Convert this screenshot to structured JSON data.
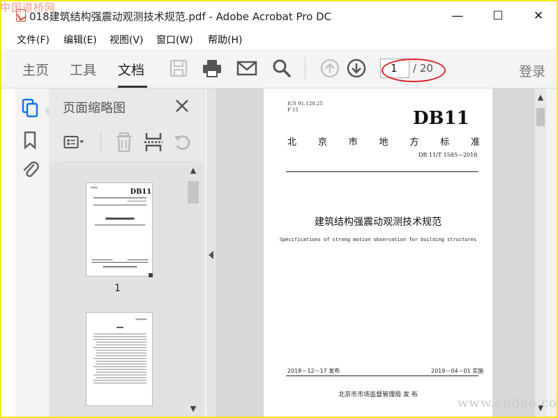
{
  "watermark_top": "中国道桥网",
  "watermark_bottom": "www.cndao.com",
  "window": {
    "title": "018建筑结构强震动观测技术规范.pdf - Adobe Acrobat Pro DC",
    "minimize": "—",
    "maximize": "☐",
    "close": "✕"
  },
  "menu": [
    "文件(F)",
    "编辑(E)",
    "视图(V)",
    "窗口(W)",
    "帮助(H)"
  ],
  "tabs": [
    {
      "label": "主页",
      "active": false
    },
    {
      "label": "工具",
      "active": false
    },
    {
      "label": "文档",
      "active": true
    }
  ],
  "toolbar_icons": [
    "save-icon",
    "print-icon",
    "email-icon",
    "search-icon",
    "page-up-icon",
    "page-down-icon"
  ],
  "page_nav": {
    "current": "1",
    "total": "/ 20"
  },
  "login_label": "登录",
  "sidebar": {
    "icons": [
      "page-thumbnails-icon",
      "bookmark-icon",
      "attachment-icon"
    ],
    "panel_title": "页面缩略图",
    "panel_tools": [
      "options-menu-icon",
      "delete-page-icon",
      "insert-page-icon",
      "undo-icon"
    ],
    "thumbnails": [
      {
        "label": "1"
      }
    ]
  },
  "document": {
    "ics": "ICS 91.120.25",
    "classification": "P 15",
    "standard_code": "DB11",
    "issuer_chars": [
      "北",
      "京",
      "市",
      "地",
      "方",
      "标",
      "准"
    ],
    "standard_number": "DB 11/T 1585—2018",
    "title_cn": "建筑结构强震动观测技术规范",
    "title_en": "Specifications of strong motion observation for building structures",
    "release_date": "2018－12－17 发布",
    "implement_date": "2019－04－01 实施",
    "publisher": "北京市市场监督管理局     发 布"
  },
  "colors": {
    "highlight_oval": "#e02020",
    "frame": "#f0e90c"
  }
}
